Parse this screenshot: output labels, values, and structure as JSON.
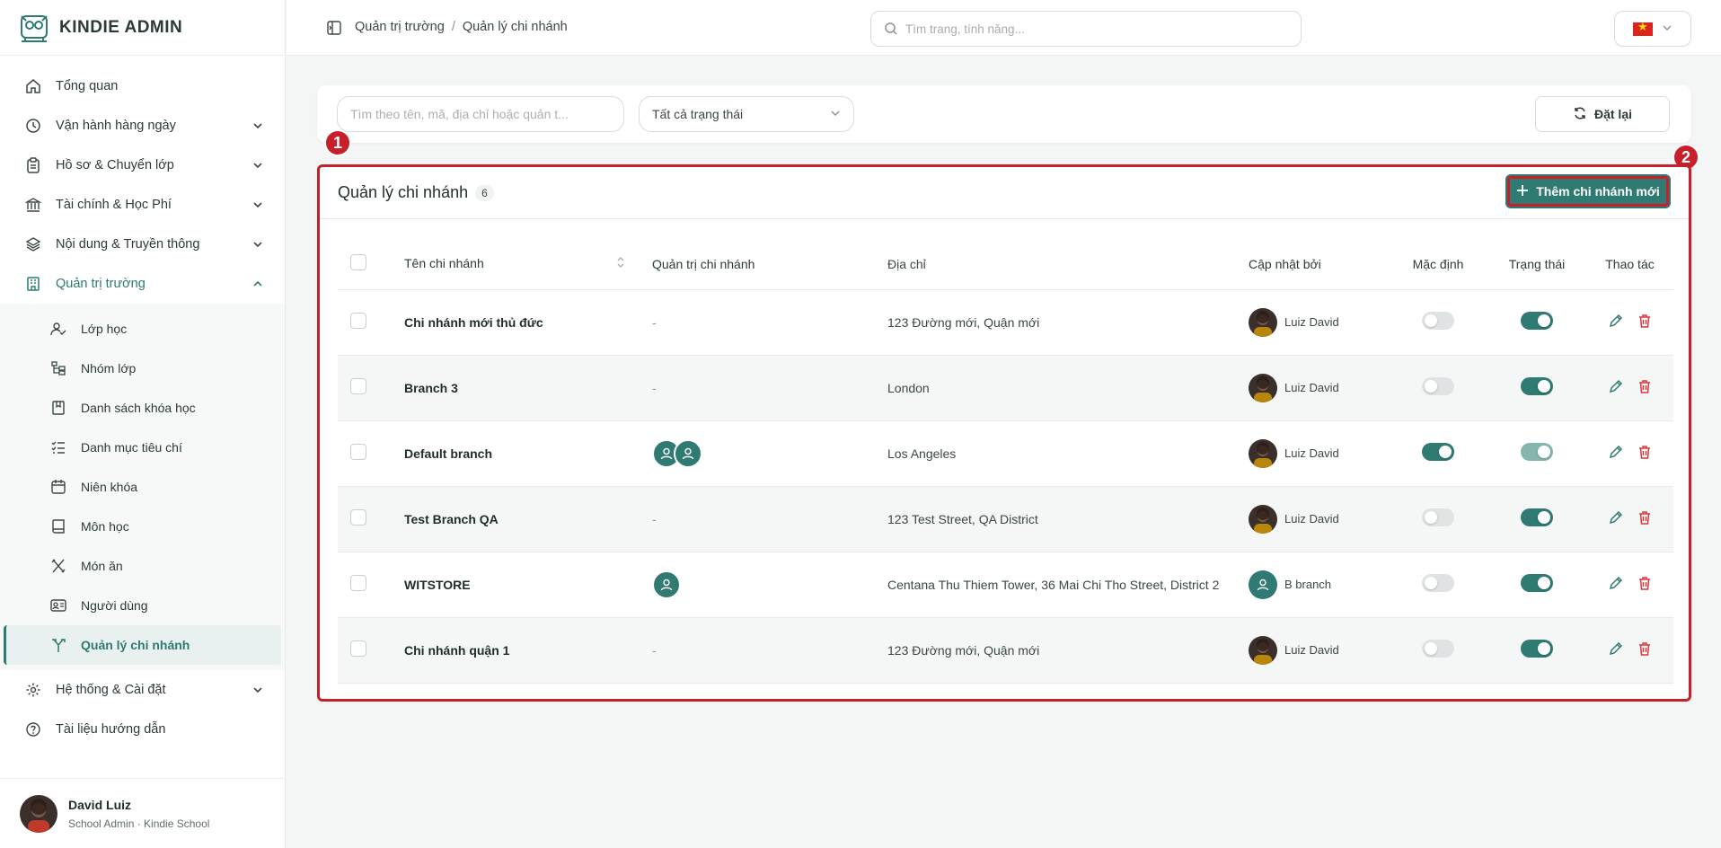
{
  "app": {
    "brand": "KINDIE ADMIN"
  },
  "sidebar": {
    "items": [
      {
        "label": "Tổng quan",
        "icon": "home-icon"
      },
      {
        "label": "Vận hành hàng ngày",
        "icon": "clock-icon"
      },
      {
        "label": "Hồ sơ & Chuyển lớp",
        "icon": "clipboard-icon"
      },
      {
        "label": "Tài chính & Học Phí",
        "icon": "bank-icon"
      },
      {
        "label": "Nội dung & Truyền thông",
        "icon": "layers-icon"
      },
      {
        "label": "Quản trị trường",
        "icon": "building-icon"
      }
    ],
    "sub_items": [
      {
        "label": "Lớp học",
        "icon": "user-check-icon"
      },
      {
        "label": "Nhóm lớp",
        "icon": "tree-icon"
      },
      {
        "label": "Danh sách khóa học",
        "icon": "book-mark-icon"
      },
      {
        "label": "Danh mục tiêu chí",
        "icon": "checklist-icon"
      },
      {
        "label": "Niên khóa",
        "icon": "calendar-icon"
      },
      {
        "label": "Môn học",
        "icon": "book-icon"
      },
      {
        "label": "Món ăn",
        "icon": "utensils-icon"
      },
      {
        "label": "Người dùng",
        "icon": "id-card-icon"
      },
      {
        "label": "Quản lý chi nhánh",
        "icon": "branch-icon"
      }
    ],
    "bottom_items": [
      {
        "label": "Hệ thống & Cài đặt",
        "icon": "gear-icon"
      },
      {
        "label": "Tài liệu hướng dẫn",
        "icon": "help-icon"
      }
    ],
    "user": {
      "name": "David Luiz",
      "role": "School Admin · Kindie School"
    }
  },
  "topbar": {
    "breadcrumb": [
      "Quản trị trường",
      "/",
      "Quản lý chi nhánh"
    ],
    "search_placeholder": "Tìm trang, tính năng..."
  },
  "filters": {
    "search_placeholder": "Tìm theo tên, mã, địa chỉ hoặc quản t...",
    "status_select": "Tất cả trạng thái",
    "reset_label": "Đặt lại"
  },
  "card": {
    "title": "Quản lý chi nhánh",
    "count": "6",
    "add_button": "Thêm chi nhánh mới",
    "markers": [
      "1",
      "2"
    ]
  },
  "table": {
    "headers": [
      "Tên chi nhánh",
      "Quản trị chi nhánh",
      "Địa chỉ",
      "Cập nhật bởi",
      "Mặc định",
      "Trạng thái",
      "Thao tác"
    ],
    "rows": [
      {
        "name": "Chi nhánh mới thủ đức",
        "admin": "-",
        "admins_count": 0,
        "address": "123 Đường mới, Quận mới",
        "updated_by": "Luiz David",
        "default": false,
        "status": true
      },
      {
        "name": "Branch 3",
        "admin": "-",
        "admins_count": 0,
        "address": "London",
        "updated_by": "Luiz David",
        "default": false,
        "status": true
      },
      {
        "name": "Default branch",
        "admin": "",
        "admins_count": 2,
        "address": "Los Angeles",
        "updated_by": "Luiz David",
        "default": true,
        "status": true
      },
      {
        "name": "Test Branch QA",
        "admin": "-",
        "admins_count": 0,
        "address": "123 Test Street, QA District",
        "updated_by": "Luiz David",
        "default": false,
        "status": true
      },
      {
        "name": "WITSTORE",
        "admin": "",
        "admins_count": 1,
        "address": "Centana Thu Thiem Tower, 36 Mai Chi Tho Street, District 2",
        "updated_by": "B branch",
        "default": false,
        "status": true
      },
      {
        "name": "Chi nhánh quận 1",
        "admin": "-",
        "admins_count": 0,
        "address": "123 Đường mới, Quận mới",
        "updated_by": "Luiz David",
        "default": false,
        "status": true
      }
    ]
  },
  "colors": {
    "primary": "#2f7a72",
    "highlight": "#c8202a"
  }
}
